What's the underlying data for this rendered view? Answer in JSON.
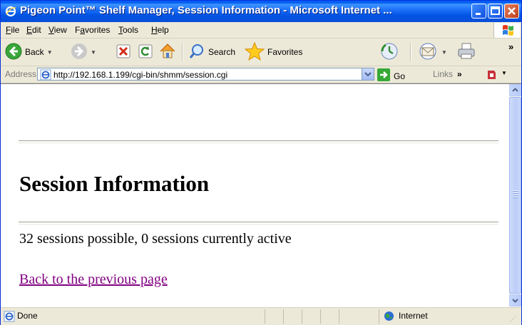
{
  "window": {
    "title": "Pigeon Point™ Shelf Manager, Session Information - Microsoft Internet ...",
    "controls": [
      "minimize",
      "maximize",
      "close"
    ]
  },
  "menu": {
    "items": [
      {
        "label": "File",
        "accel": "F",
        "rest": "ile"
      },
      {
        "label": "Edit",
        "accel": "E",
        "rest": "dit"
      },
      {
        "label": "View",
        "accel": "V",
        "rest": "iew"
      },
      {
        "label": "Favorites",
        "pre": "F",
        "accel": "a",
        "rest": "vorites"
      },
      {
        "label": "Tools",
        "accel": "T",
        "rest": "ools"
      },
      {
        "label": "Help",
        "accel": "H",
        "rest": "elp"
      }
    ]
  },
  "toolbar": {
    "back_label": "Back",
    "search_label": "Search",
    "favorites_label": "Favorites",
    "overflow": "»"
  },
  "address": {
    "label": "Address",
    "url": "http://192.168.1.199/cgi-bin/shmm/session.cgi",
    "go_label": "Go",
    "links_label": "Links",
    "links_overflow": "»"
  },
  "page": {
    "heading": "Session Information",
    "session_text": "32 sessions possible, 0 sessions currently active",
    "back_link": "Back to the previous page"
  },
  "status": {
    "left_text": "Done",
    "zone_text": "Internet"
  },
  "colors": {
    "titlebar": "#0054e3",
    "link_visited": "#800080",
    "content_bg": "#ffffff",
    "chrome_bg": "#ece9d8"
  }
}
